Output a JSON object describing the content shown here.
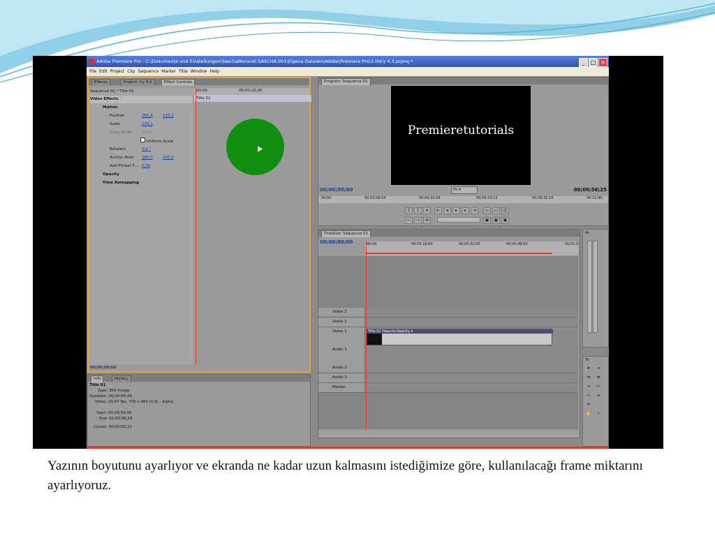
{
  "app": {
    "title": "Adobe Premiere Pro - C:\\Dokumente und Einstellungen\\SaschaMorandi.SASCHA.001\\Eigene Dateien\\Adobe\\Premiere Pro\\3.0\\try 4.3.prproj *",
    "menu": [
      "File",
      "Edit",
      "Project",
      "Clip",
      "Sequence",
      "Marker",
      "Title",
      "Window",
      "Help"
    ]
  },
  "effects_panel": {
    "tabs": [
      "Effects",
      "Project: try 4.3",
      "Effect Controls"
    ],
    "header": "Sequence 01 * Title 01",
    "section": "Video Effects",
    "motion": "Motion",
    "position_label": "Position",
    "position_x": "285,4",
    "position_y": "293,3",
    "scale_label": "Scale",
    "scale_value": "134,1",
    "scale_width_label": "Scale Width",
    "scale_width_value": "134,1",
    "uniform_scale": "Uniform Scale",
    "rotation_label": "Rotation",
    "rotation_value": "0,0 °",
    "anchor_label": "Anchor Point",
    "anchor_x": "360,0",
    "anchor_y": "240,0",
    "antiflicker_label": "Anti-Flicker F...",
    "antiflicker_value": "0,00",
    "opacity": "Opacity",
    "time_remapping": "Time Remapping",
    "ruler_start": "00;00",
    "ruler_mid": "00;00;32;00",
    "clip_label": "Title 01",
    "timecode": "00;00;00;00"
  },
  "info_panel": {
    "tabs": [
      "Info",
      "History"
    ],
    "clip_title": "Title 01",
    "type": "Type: Still Image",
    "duration": "Duration: 00;00;56;25",
    "video": "Video: 29,97 fps, 720 x 480 (0,9) - Alpha",
    "start": "Start: 00;00;00;00",
    "end": "End: 00;00;56;24",
    "cursor": "Cursor: 00;00;03;22"
  },
  "program_monitor": {
    "tab": "Program: Sequence 01",
    "video_text": "Premieretutorials",
    "timecode_left": "00;00;00;00",
    "fit": "Fit",
    "timecode_right": "00;00;56;25",
    "ruler": [
      "00;00",
      "00;02;08;04",
      "00;04;16;08",
      "00;06;24;12",
      "00;08;32;16",
      "00;10;40;"
    ]
  },
  "timeline": {
    "tab": "Timeline: Sequence 01",
    "timecode": "00;00;00;00",
    "ruler": [
      "00;00",
      "00;00;16;00",
      "00;00;32;00",
      "00;00;48;00",
      "00;01;0"
    ],
    "tracks": [
      "Video 3",
      "Video 2",
      "Video 1",
      "Audio 1",
      "Audio 2",
      "Audio 3",
      "Master"
    ],
    "clip_label": "Title 01  Opacity:Opacity ▾"
  },
  "audio_meter": {
    "label": "Ar"
  },
  "tools_panel": {
    "label": "To"
  },
  "caption": "Yazının boyutunu ayarlıyor ve ekranda ne kadar uzun kalmasını istediğimize göre, kullanılacağı frame miktarını ayarlıyoruz.",
  "colors": {
    "accent": "#e8a23a",
    "playhead": "#e03a2b",
    "circle": "#108e10",
    "titlebar": "#2d55b8"
  }
}
